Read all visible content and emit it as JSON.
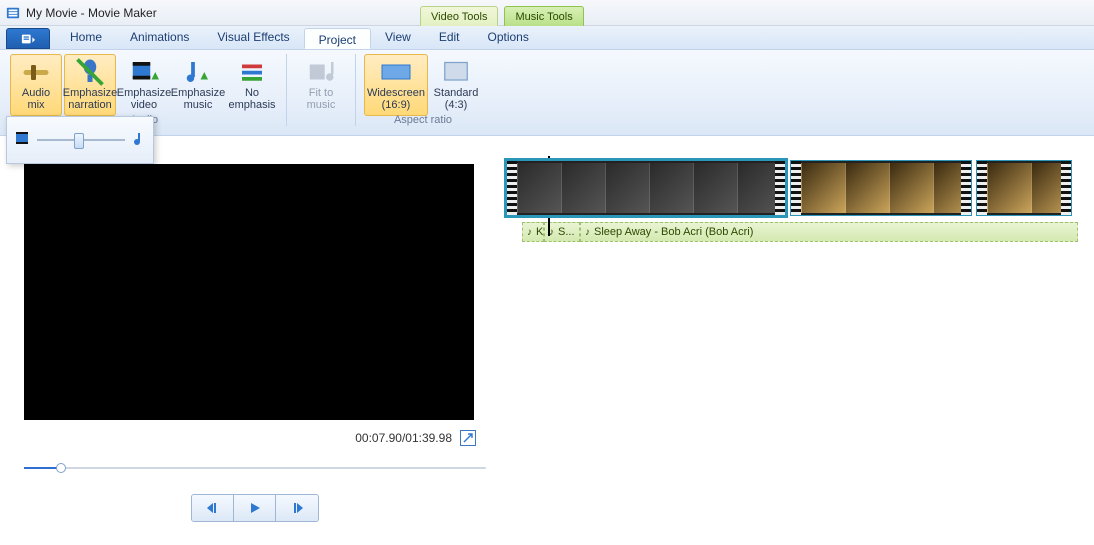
{
  "title": "My Movie - Movie Maker",
  "contextual_tabs": {
    "video": "Video Tools",
    "music": "Music Tools"
  },
  "tabs": {
    "home": "Home",
    "animations": "Animations",
    "visual_effects": "Visual Effects",
    "project": "Project",
    "view": "View",
    "edit": "Edit",
    "options": "Options"
  },
  "ribbon": {
    "audio_group_label": "Audio",
    "aspect_group_label": "Aspect ratio",
    "audio_mix": {
      "line1": "Audio",
      "line2": "mix"
    },
    "emph_narration": {
      "line1": "Emphasize",
      "line2": "narration"
    },
    "emph_video": {
      "line1": "Emphasize",
      "line2": "video"
    },
    "emph_music": {
      "line1": "Emphasize",
      "line2": "music"
    },
    "no_emph": {
      "line1": "No",
      "line2": "emphasis"
    },
    "fit_to_music": {
      "line1": "Fit to",
      "line2": "music"
    },
    "widescreen": {
      "line1": "Widescreen",
      "line2": "(16:9)"
    },
    "standard": {
      "line1": "Standard",
      "line2": "(4:3)"
    }
  },
  "preview": {
    "timecode": "00:07.90/01:39.98"
  },
  "timeline": {
    "audio_clips": [
      {
        "label": "K"
      },
      {
        "label": "S..."
      },
      {
        "label": "Sleep Away - Bob Acri (Bob Acri)"
      }
    ]
  }
}
